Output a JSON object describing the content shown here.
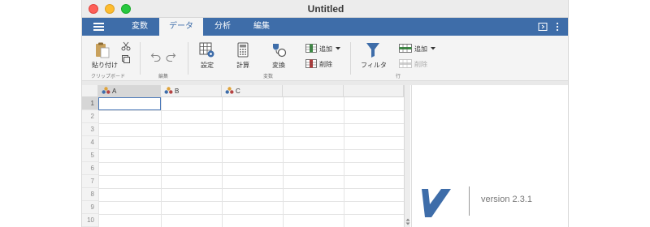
{
  "window": {
    "title": "Untitled"
  },
  "menu": {
    "tabs": [
      {
        "label": "変数"
      },
      {
        "label": "データ"
      },
      {
        "label": "分析"
      },
      {
        "label": "編集"
      }
    ],
    "active_tab": "データ"
  },
  "ribbon": {
    "clipboard": {
      "paste_label": "貼り付け",
      "group_label": "クリップボード"
    },
    "edit": {
      "group_label": "編集"
    },
    "variables": {
      "setup_label": "設定",
      "compute_label": "計算",
      "transform_label": "変換",
      "add_label": "追加",
      "delete_label": "削除",
      "group_label": "変数"
    },
    "rows": {
      "filter_label": "フィルタ",
      "add_label": "追加",
      "delete_label": "削除",
      "group_label": "行"
    }
  },
  "sheet": {
    "columns": [
      "A",
      "B",
      "C"
    ],
    "row_numbers": [
      "1",
      "2",
      "3",
      "4",
      "5",
      "6",
      "7",
      "8",
      "9",
      "10"
    ]
  },
  "splash": {
    "version": "version 2.3.1"
  },
  "colors": {
    "accent": "#3e6da9",
    "active_cell": "#4a78b8"
  }
}
